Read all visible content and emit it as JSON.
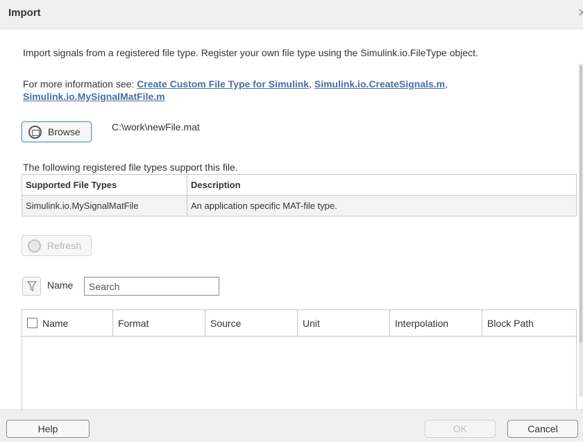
{
  "window": {
    "title": "Import",
    "close_glyph": "✕"
  },
  "intro_text": "Import signals from a registered file type. Register your own file type using the Simulink.io.FileType object.",
  "info": {
    "prefix": "For more information see: ",
    "links": [
      "Create Custom File Type for Simulink",
      "Simulink.io.CreateSignals.m",
      "Simulink.io.MySignalMatFile.m"
    ],
    "separator": ",  "
  },
  "browse": {
    "label": "Browse",
    "file_path": "C:\\work\\newFile.mat",
    "icon": "folder-icon"
  },
  "registered": {
    "label": "The following registered file types support this file.",
    "headers": [
      "Supported File Types",
      "Description"
    ],
    "rows": [
      [
        "Simulink.io.MySignalMatFile",
        "An application specific MAT-file type."
      ]
    ]
  },
  "refresh": {
    "label": "Refresh",
    "icon": "refresh-icon",
    "enabled": false
  },
  "filter": {
    "icon": "filter-icon",
    "label": "Name",
    "placeholder": "Search"
  },
  "signals_table": {
    "headers": [
      "Name",
      "Format",
      "Source",
      "Unit",
      "Interpolation",
      "Block Path"
    ],
    "rows": []
  },
  "footer": {
    "help_label": "Help",
    "ok_label": "OK",
    "cancel_label": "Cancel",
    "ok_enabled": false
  },
  "colors": {
    "link": "#4a6fa5",
    "focus_border": "#5b9bd5",
    "chrome": "#f0f0f0"
  }
}
